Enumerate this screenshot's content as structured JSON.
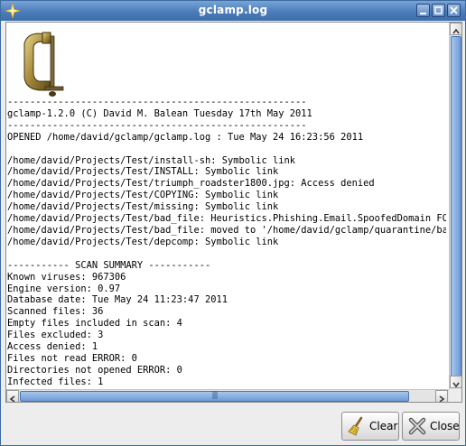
{
  "window": {
    "title": "gclamp.log",
    "title_icon": "sparkle-icon",
    "controls": [
      "minimize-icon",
      "maximize-icon",
      "close-icon"
    ]
  },
  "logo": {
    "name": "c-clamp-logo"
  },
  "log": {
    "lines": [
      "-----------------------------------------------------",
      "gclamp-1.2.0 (C) David M. Balean Tuesday 17th May 2011",
      "-----------------------------------------------------",
      "OPENED /home/david/gclamp/gclamp.log : Tue May 24 16:23:56 2011",
      "",
      "/home/david/Projects/Test/install-sh: Symbolic link",
      "/home/david/Projects/Test/INSTALL: Symbolic link",
      "/home/david/Projects/Test/triumph_roadster1800.jpg: Access denied",
      "/home/david/Projects/Test/COPYING: Symbolic link",
      "/home/david/Projects/Test/missing: Symbolic link",
      "/home/david/Projects/Test/bad_file: Heuristics.Phishing.Email.SpoofedDomain FOUND",
      "/home/david/Projects/Test/bad_file: moved to '/home/david/gclamp/quarantine/bad_f",
      "/home/david/Projects/Test/depcomp: Symbolic link",
      "",
      "----------- SCAN SUMMARY -----------",
      "Known viruses: 967306",
      "Engine version: 0.97",
      "Database date: Tue May 24 11:23:47 2011",
      "Scanned files: 36",
      "Empty files included in scan: 4",
      "Files excluded: 3",
      "Access denied: 1",
      "Files not read ERROR: 0",
      "Directories not opened ERROR: 0",
      "Infected files: 1"
    ]
  },
  "scrollbars": {
    "horizontal_grip": "|||"
  },
  "buttons": {
    "clear": {
      "label": "Clear",
      "icon": "broom-icon"
    },
    "close": {
      "label": "Close",
      "icon": "close-x-icon"
    }
  }
}
